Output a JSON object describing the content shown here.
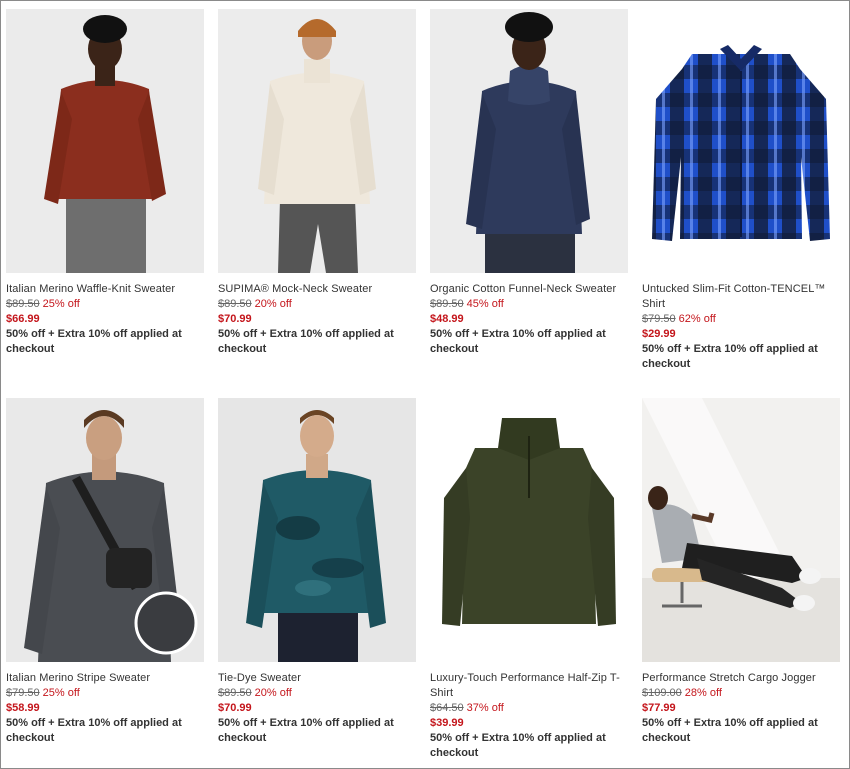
{
  "products": [
    {
      "name": "Italian Merino Waffle-Knit Sweater",
      "original_price": "$89.50",
      "discount": "25% off",
      "sale_price": "$66.99",
      "promo": "50% off + Extra 10% off applied at checkout"
    },
    {
      "name": "SUPIMA® Mock-Neck Sweater",
      "original_price": "$89.50",
      "discount": "20% off",
      "sale_price": "$70.99",
      "promo": "50% off + Extra 10% off applied at checkout"
    },
    {
      "name": "Organic Cotton Funnel-Neck Sweater",
      "original_price": "$89.50",
      "discount": "45% off",
      "sale_price": "$48.99",
      "promo": "50% off + Extra 10% off applied at checkout"
    },
    {
      "name": "Untucked Slim-Fit Cotton-TENCEL™ Shirt",
      "original_price": "$79.50",
      "discount": "62% off",
      "sale_price": "$29.99",
      "promo": "50% off + Extra 10% off applied at checkout"
    },
    {
      "name": "Italian Merino Stripe Sweater",
      "original_price": "$79.50",
      "discount": "25% off",
      "sale_price": "$58.99",
      "promo": "50% off + Extra 10% off applied at checkout"
    },
    {
      "name": "Tie-Dye Sweater",
      "original_price": "$89.50",
      "discount": "20% off",
      "sale_price": "$70.99",
      "promo": "50% off + Extra 10% off applied at checkout"
    },
    {
      "name": "Luxury-Touch Performance Half-Zip T-Shirt",
      "original_price": "$64.50",
      "discount": "37% off",
      "sale_price": "$39.99",
      "promo": "50% off + Extra 10% off applied at checkout"
    },
    {
      "name": "Performance Stretch Cargo Jogger",
      "original_price": "$109.00",
      "discount": "28% off",
      "sale_price": "$77.99",
      "promo": "50% off + Extra 10% off applied at checkout"
    }
  ],
  "colors": {
    "sale_red": "#c4161c",
    "text": "#333333",
    "image_bg": "#ececec"
  }
}
